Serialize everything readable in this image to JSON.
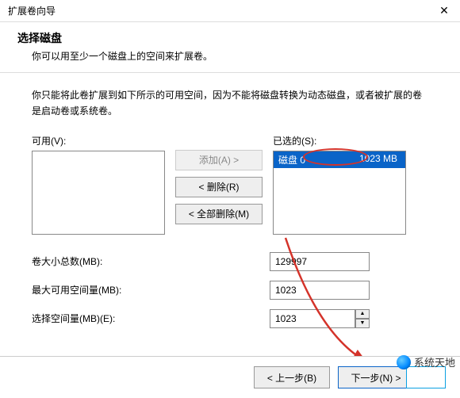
{
  "window": {
    "title": "扩展卷向导",
    "close": "✕"
  },
  "header": {
    "title": "选择磁盘",
    "subtitle": "你可以用至少一个磁盘上的空间来扩展卷。"
  },
  "desc": "你只能将此卷扩展到如下所示的可用空间，因为不能将磁盘转换为动态磁盘，或者被扩展的卷是启动卷或系统卷。",
  "labels": {
    "available": "可用(V):",
    "selected": "已选的(S):"
  },
  "buttons": {
    "add": "添加(A) >",
    "remove": "< 删除(R)",
    "removeAll": "< 全部删除(M)",
    "back": "< 上一步(B)",
    "next": "下一步(N) >",
    "cancel": ""
  },
  "selected_items": [
    {
      "name": "磁盘 0",
      "size": "1023 MB"
    }
  ],
  "fields": {
    "total_label": "卷大小总数(MB):",
    "total_value": "129997",
    "max_label": "最大可用空间量(MB):",
    "max_value": "1023",
    "choose_label": "选择空间量(MB)(E):",
    "choose_value": "1023"
  },
  "watermark": "系统天地"
}
